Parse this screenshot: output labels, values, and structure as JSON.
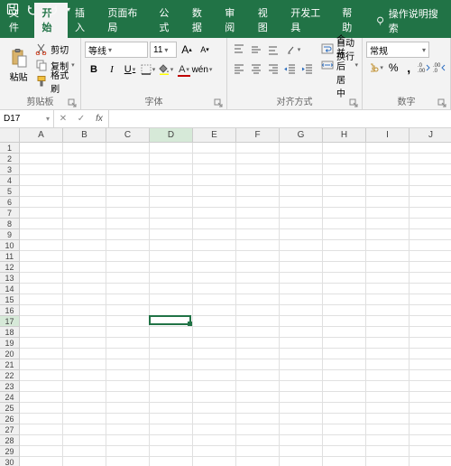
{
  "titlebar": {
    "save_title": "保存",
    "undo_title": "撤销",
    "redo_title": "恢复"
  },
  "tabs": {
    "file": "文件",
    "home": "开始",
    "insert": "插入",
    "layout": "页面布局",
    "formulas": "公式",
    "data": "数据",
    "review": "审阅",
    "view": "视图",
    "developer": "开发工具",
    "help": "帮助",
    "tellme": "操作说明搜索"
  },
  "ribbon": {
    "clipboard": {
      "paste": "粘贴",
      "cut": "剪切",
      "copy": "复制",
      "format_painter": "格式刷",
      "label": "剪贴板"
    },
    "font": {
      "family": "等线",
      "size": "11",
      "increase_title": "增大字号",
      "decrease_title": "减小字号",
      "bold": "B",
      "italic": "I",
      "underline": "U",
      "label": "字体"
    },
    "alignment": {
      "wrap": "自动换行",
      "merge": "合并后居中",
      "label": "对齐方式"
    },
    "number": {
      "format": "常规",
      "label": "数字"
    }
  },
  "formula_bar": {
    "namebox": "D17",
    "fx": "fx",
    "value": ""
  },
  "grid": {
    "columns": [
      "A",
      "B",
      "C",
      "D",
      "E",
      "F",
      "G",
      "H",
      "I",
      "J"
    ],
    "rows": 30,
    "active": {
      "col": 3,
      "row": 16
    }
  }
}
